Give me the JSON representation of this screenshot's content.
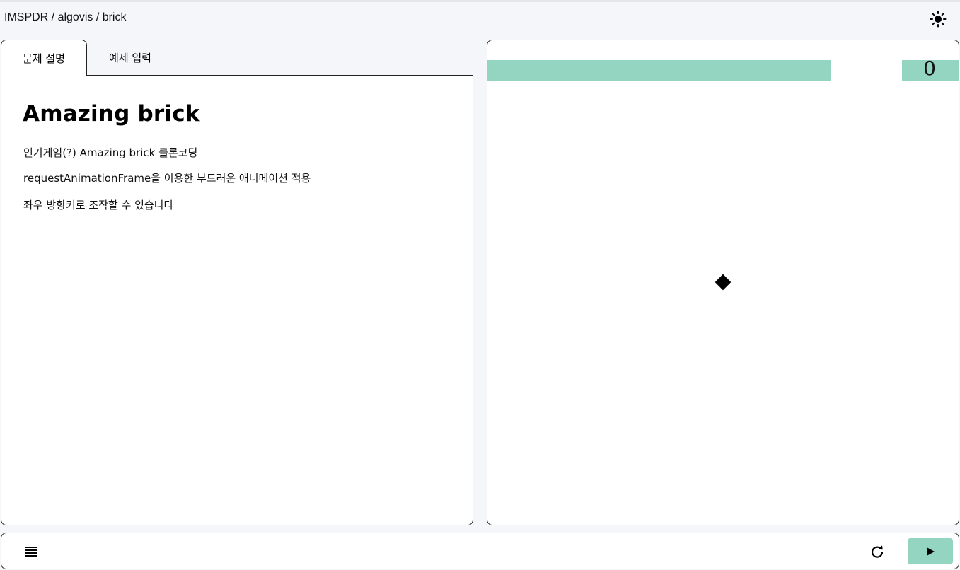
{
  "header": {
    "breadcrumb": "IMSPDR / algovis / brick",
    "theme_icon": "sun-icon"
  },
  "tabs": [
    {
      "label": "문제 설명",
      "active": true
    },
    {
      "label": "예제 입력",
      "active": false
    }
  ],
  "description": {
    "title": "Amazing brick",
    "lines": [
      "인기게임(?) Amazing brick 클론코딩",
      "requestAnimationFrame을 이용한 부드러운 애니메이션 적용",
      "좌우 방향키로 조작할 수 있습니다"
    ]
  },
  "game": {
    "score": "0",
    "brick_color": "#94d5c1",
    "player_color": "#000000"
  },
  "bottom_bar": {
    "menu_icon": "menu-icon",
    "reload_icon": "reload-icon",
    "play_icon": "play-icon",
    "play_button_color": "#94d5c1"
  }
}
